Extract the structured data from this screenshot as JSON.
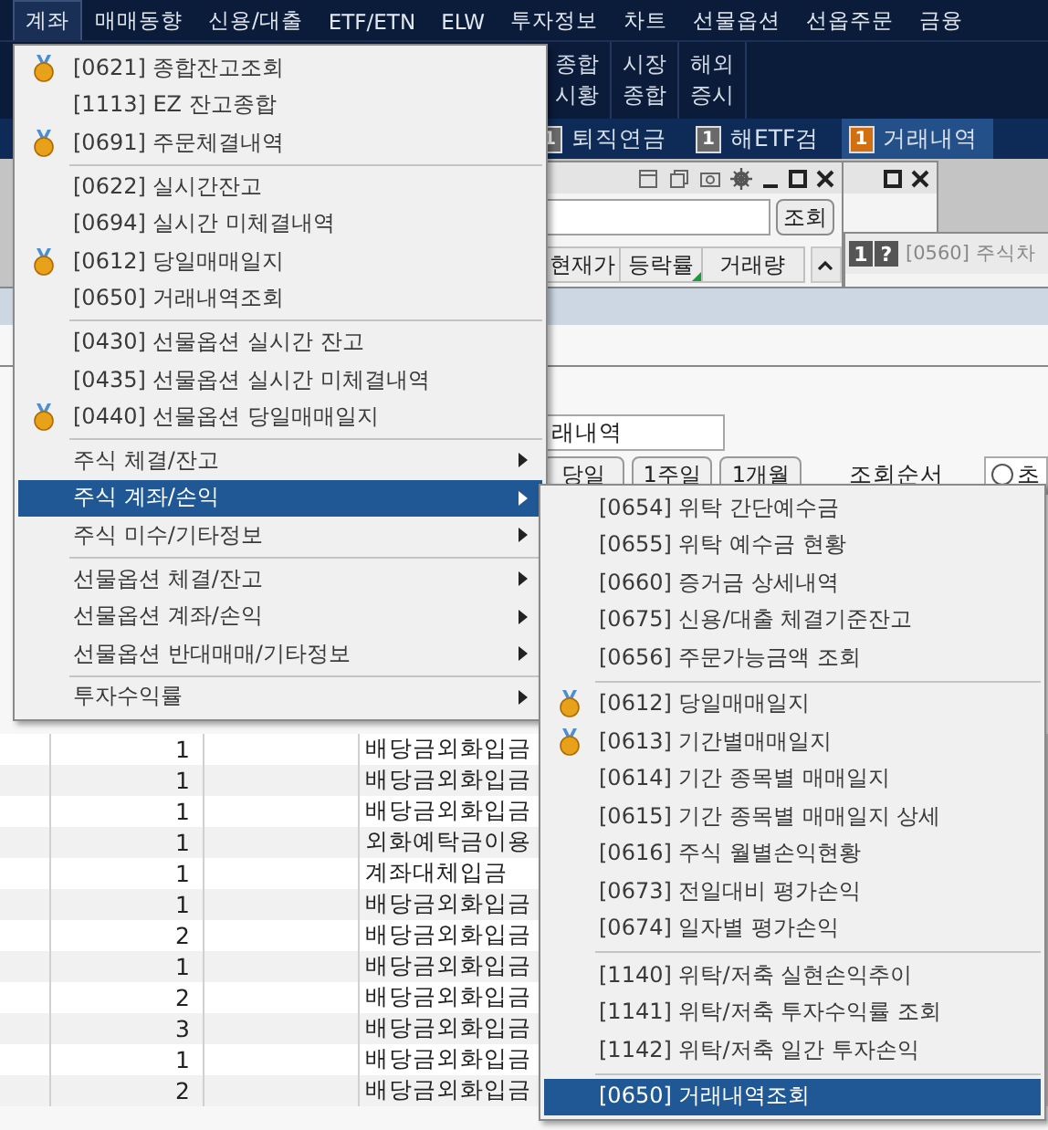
{
  "menubar": [
    {
      "label": "계좌",
      "selected": true
    },
    {
      "label": "매매동향",
      "selected": false
    },
    {
      "label": "신용/대출",
      "selected": false
    },
    {
      "label": "ETF/ETN",
      "selected": false
    },
    {
      "label": "ELW",
      "selected": false
    },
    {
      "label": "투자정보",
      "selected": false
    },
    {
      "label": "차트",
      "selected": false
    },
    {
      "label": "선물옵션",
      "selected": false
    },
    {
      "label": "선옵주문",
      "selected": false
    },
    {
      "label": "금융",
      "selected": false
    }
  ],
  "toolbar": [
    {
      "lines": [
        "종합",
        "시황"
      ]
    },
    {
      "lines": [
        "시장",
        "종합"
      ]
    },
    {
      "lines": [
        "해외",
        "증시"
      ]
    }
  ],
  "tabs": [
    {
      "badge": "1",
      "label": "퇴직연금",
      "selected": false
    },
    {
      "badge": "1",
      "label": "해ETF검",
      "selected": false
    },
    {
      "badge": "1",
      "label": "거래내역",
      "selected": true
    }
  ],
  "quote_window": {
    "search_button": "조회",
    "columns": [
      "현재가",
      "등락률",
      "거래량"
    ]
  },
  "chart_window": {
    "badges": [
      "1",
      "?"
    ],
    "title": "[0560] 주식차"
  },
  "history_window": {
    "account_field": "래내역",
    "period_buttons": [
      "당일",
      "1주일",
      "1개월"
    ],
    "order_label": "조회순서",
    "order_option": {
      "label": "초",
      "selected": false
    },
    "rows": [
      {
        "count": "1",
        "type": "배당금외화입금"
      },
      {
        "count": "1",
        "type": "배당금외화입금"
      },
      {
        "count": "1",
        "type": "배당금외화입금"
      },
      {
        "count": "1",
        "type": "외화예탁금이용"
      },
      {
        "count": "1",
        "type": "계좌대체입금"
      },
      {
        "count": "1",
        "type": "배당금외화입금"
      },
      {
        "count": "2",
        "type": "배당금외화입금"
      },
      {
        "count": "1",
        "type": "배당금외화입금"
      },
      {
        "count": "2",
        "type": "배당금외화입금"
      },
      {
        "count": "3",
        "type": "배당금외화입금"
      },
      {
        "count": "1",
        "type": "배당금외화입금"
      },
      {
        "count": "2",
        "type": "배당금외화입금"
      }
    ]
  },
  "account_menu": {
    "items": [
      {
        "kind": "item",
        "label": "[0621] 종합잔고조회",
        "favorite": true,
        "selected": false
      },
      {
        "kind": "item",
        "label": "[1113] EZ 잔고종합",
        "favorite": false,
        "selected": false
      },
      {
        "kind": "item",
        "label": "[0691] 주문체결내역",
        "favorite": true,
        "selected": false
      },
      {
        "kind": "separator"
      },
      {
        "kind": "item",
        "label": "[0622] 실시간잔고",
        "favorite": false,
        "selected": false
      },
      {
        "kind": "item",
        "label": "[0694] 실시간 미체결내역",
        "favorite": false,
        "selected": false
      },
      {
        "kind": "item",
        "label": "[0612] 당일매매일지",
        "favorite": true,
        "selected": false
      },
      {
        "kind": "item",
        "label": "[0650] 거래내역조회",
        "favorite": false,
        "selected": false
      },
      {
        "kind": "separator"
      },
      {
        "kind": "item",
        "label": "[0430] 선물옵션 실시간 잔고",
        "favorite": false,
        "selected": false
      },
      {
        "kind": "item",
        "label": "[0435] 선물옵션 실시간 미체결내역",
        "favorite": false,
        "selected": false
      },
      {
        "kind": "item",
        "label": "[0440] 선물옵션 당일매매일지",
        "favorite": true,
        "selected": false
      },
      {
        "kind": "separator"
      },
      {
        "kind": "submenu",
        "label": "주식 체결/잔고",
        "selected": false
      },
      {
        "kind": "submenu",
        "label": "주식 계좌/손익",
        "selected": true
      },
      {
        "kind": "submenu",
        "label": "주식 미수/기타정보",
        "selected": false
      },
      {
        "kind": "separator"
      },
      {
        "kind": "submenu",
        "label": "선물옵션 체결/잔고",
        "selected": false
      },
      {
        "kind": "submenu",
        "label": "선물옵션 계좌/손익",
        "selected": false
      },
      {
        "kind": "submenu",
        "label": "선물옵션 반대매매/기타정보",
        "selected": false
      },
      {
        "kind": "separator"
      },
      {
        "kind": "submenu",
        "label": "투자수익률",
        "selected": false
      }
    ]
  },
  "submenu": {
    "items": [
      {
        "kind": "item",
        "label": "[0654] 위탁 간단예수금",
        "favorite": false,
        "selected": false
      },
      {
        "kind": "item",
        "label": "[0655] 위탁 예수금 현황",
        "favorite": false,
        "selected": false
      },
      {
        "kind": "item",
        "label": "[0660] 증거금 상세내역",
        "favorite": false,
        "selected": false
      },
      {
        "kind": "item",
        "label": "[0675] 신용/대출 체결기준잔고",
        "favorite": false,
        "selected": false
      },
      {
        "kind": "item",
        "label": "[0656] 주문가능금액 조회",
        "favorite": false,
        "selected": false
      },
      {
        "kind": "separator"
      },
      {
        "kind": "item",
        "label": "[0612] 당일매매일지",
        "favorite": true,
        "selected": false
      },
      {
        "kind": "item",
        "label": "[0613] 기간별매매일지",
        "favorite": true,
        "selected": false
      },
      {
        "kind": "item",
        "label": "[0614] 기간 종목별 매매일지",
        "favorite": false,
        "selected": false
      },
      {
        "kind": "item",
        "label": "[0615] 기간 종목별 매매일지 상세",
        "favorite": false,
        "selected": false
      },
      {
        "kind": "item",
        "label": "[0616] 주식 월별손익현황",
        "favorite": false,
        "selected": false
      },
      {
        "kind": "item",
        "label": "[0673] 전일대비 평가손익",
        "favorite": false,
        "selected": false
      },
      {
        "kind": "item",
        "label": "[0674] 일자별 평가손익",
        "favorite": false,
        "selected": false
      },
      {
        "kind": "separator"
      },
      {
        "kind": "item",
        "label": "[1140] 위탁/저축 실현손익추이",
        "favorite": false,
        "selected": false
      },
      {
        "kind": "item",
        "label": "[1141] 위탁/저축 투자수익률 조회",
        "favorite": false,
        "selected": false
      },
      {
        "kind": "item",
        "label": "[1142] 위탁/저축 일간 투자손익",
        "favorite": false,
        "selected": false
      },
      {
        "kind": "separator"
      },
      {
        "kind": "item",
        "label": "[0650] 거래내역조회",
        "favorite": false,
        "selected": true
      }
    ]
  }
}
